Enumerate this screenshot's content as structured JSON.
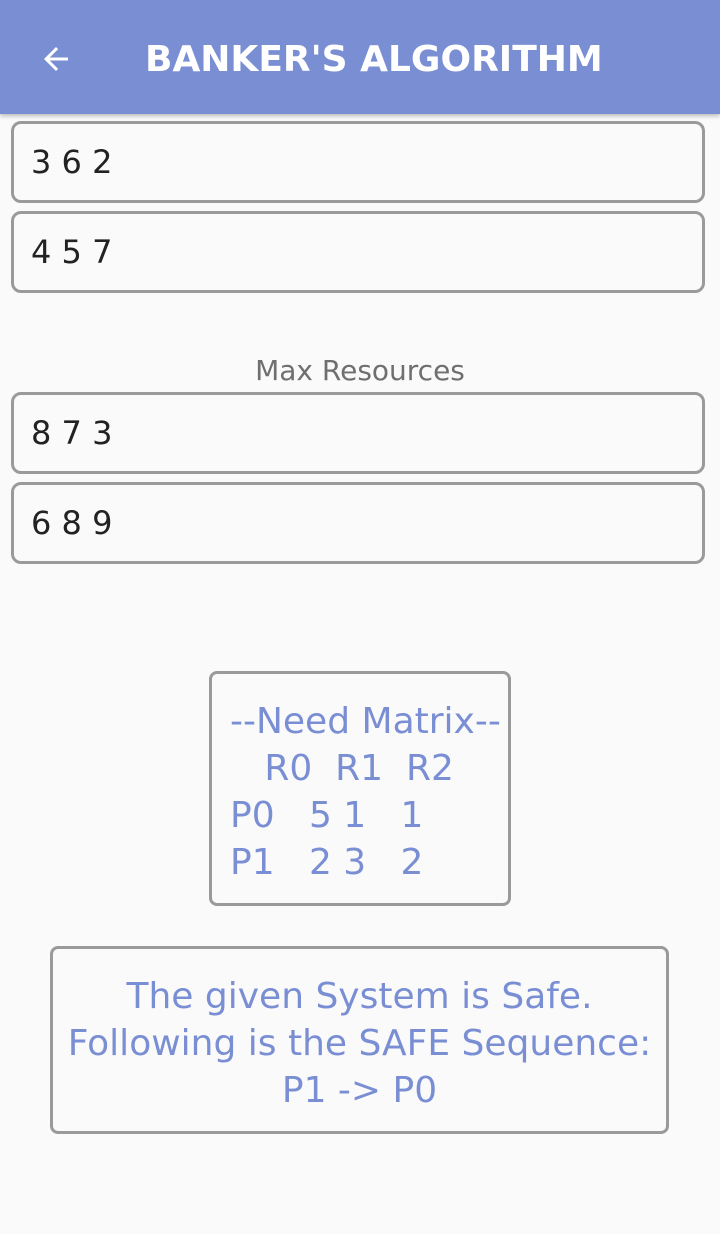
{
  "header": {
    "title": "BANKER'S ALGORITHM",
    "back_icon": "arrow-left-icon",
    "bg_color": "#7a8ed4"
  },
  "allocation_inputs": [
    "3 6 2",
    "4 5 7"
  ],
  "max_resources": {
    "label": "Max Resources",
    "inputs": [
      "8 7 3",
      "6 8 9"
    ]
  },
  "need_matrix": {
    "lines": [
      "--Need Matrix--",
      "   R0  R1  R2",
      "P0   5 1   1",
      "P1   2 3   2"
    ]
  },
  "result": {
    "lines": [
      "The given System is Safe.",
      "Following is the SAFE Sequence:",
      "P1 -> P0"
    ]
  },
  "text_color": "#7a8ed4"
}
